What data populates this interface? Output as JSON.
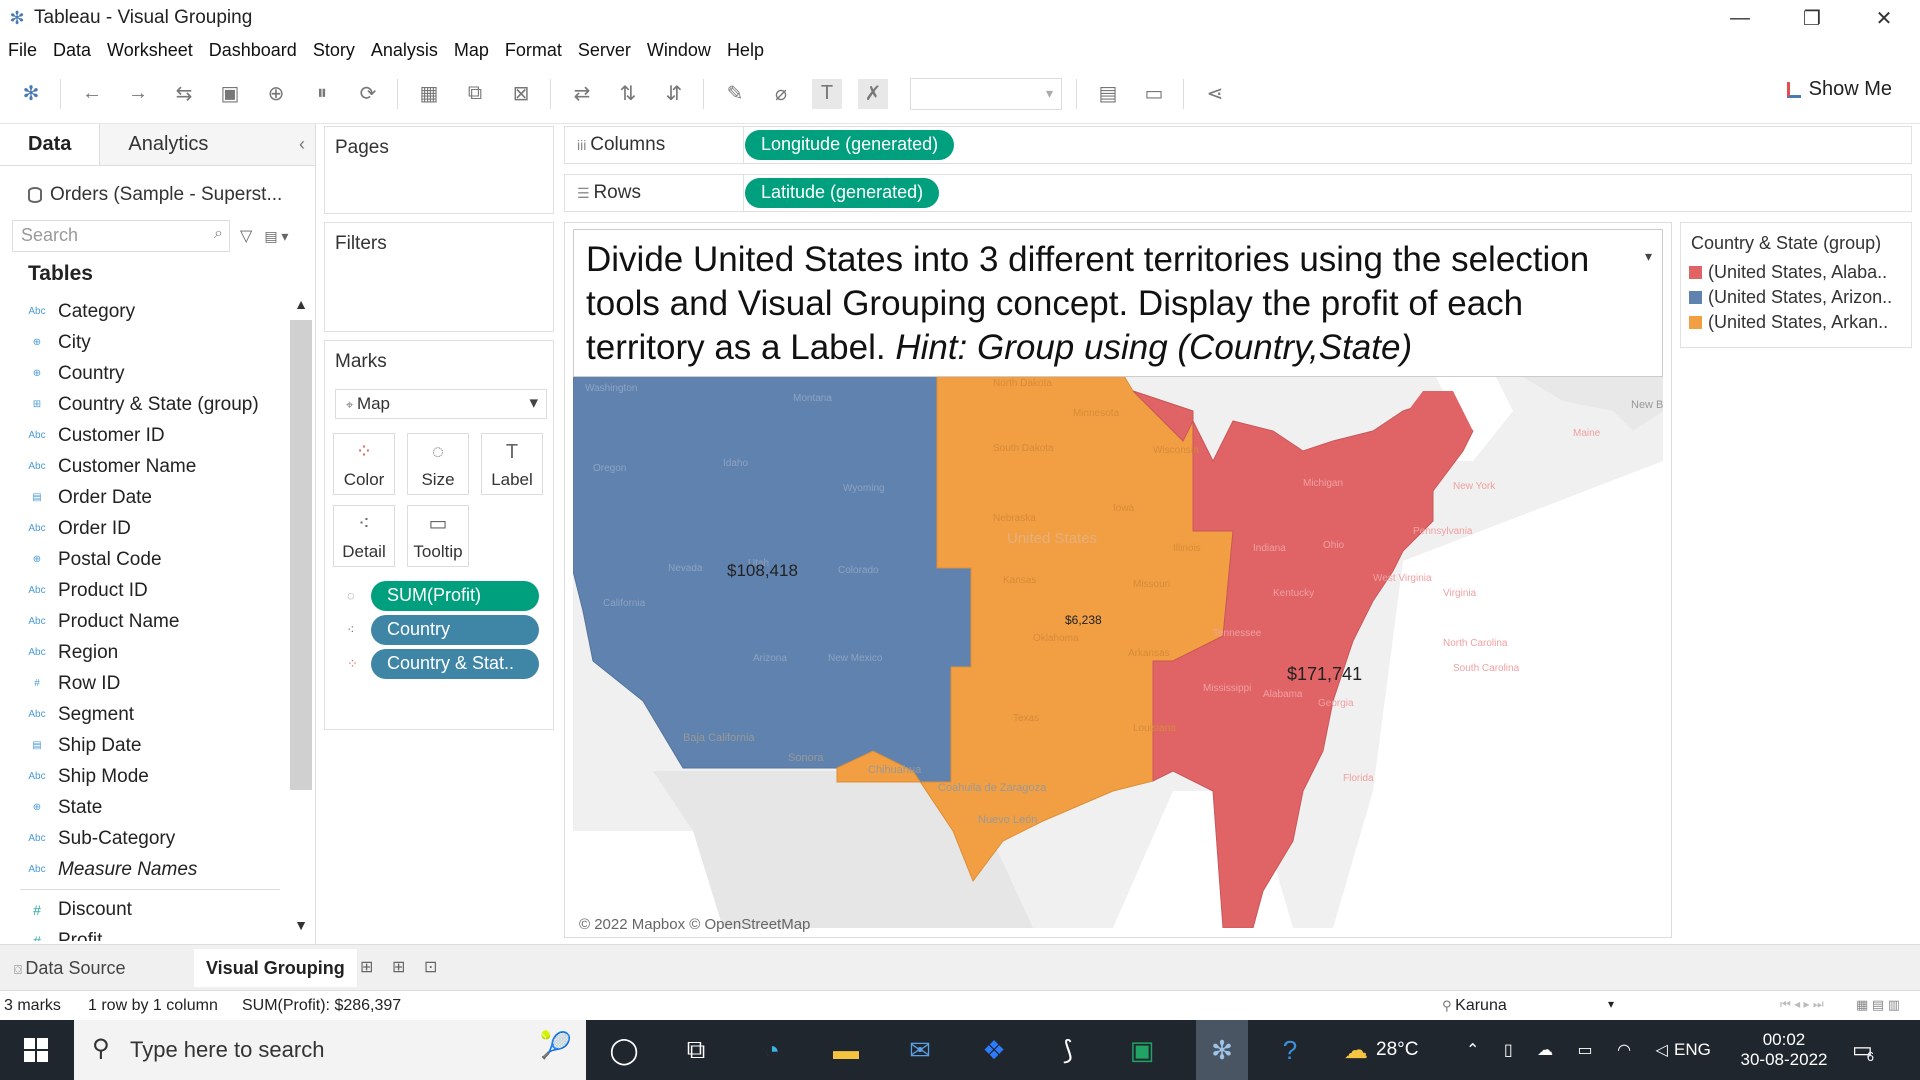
{
  "window": {
    "title": "Tableau - Visual Grouping"
  },
  "menu": [
    "File",
    "Data",
    "Worksheet",
    "Dashboard",
    "Story",
    "Analysis",
    "Map",
    "Format",
    "Server",
    "Window",
    "Help"
  ],
  "toolbar": {
    "show_me": "Show Me"
  },
  "data_pane": {
    "tab_data": "Data",
    "tab_analytics": "Analytics",
    "datasource": "Orders (Sample - Superst...",
    "search_placeholder": "Search",
    "tables_heading": "Tables",
    "dimensions": [
      {
        "icon": "Abc",
        "name": "Category"
      },
      {
        "icon": "⊕",
        "name": "City"
      },
      {
        "icon": "⊕",
        "name": "Country"
      },
      {
        "icon": "⊞",
        "name": "Country & State (group)"
      },
      {
        "icon": "Abc",
        "name": "Customer ID"
      },
      {
        "icon": "Abc",
        "name": "Customer Name"
      },
      {
        "icon": "▤",
        "name": "Order Date"
      },
      {
        "icon": "Abc",
        "name": "Order ID"
      },
      {
        "icon": "⊕",
        "name": "Postal Code"
      },
      {
        "icon": "Abc",
        "name": "Product ID"
      },
      {
        "icon": "Abc",
        "name": "Product Name"
      },
      {
        "icon": "Abc",
        "name": "Region"
      },
      {
        "icon": "#",
        "name": "Row ID"
      },
      {
        "icon": "Abc",
        "name": "Segment"
      },
      {
        "icon": "▤",
        "name": "Ship Date"
      },
      {
        "icon": "Abc",
        "name": "Ship Mode"
      },
      {
        "icon": "⊕",
        "name": "State"
      },
      {
        "icon": "Abc",
        "name": "Sub-Category"
      },
      {
        "icon": "Abc",
        "name": "Measure Names"
      }
    ],
    "measures": [
      {
        "icon": "#",
        "name": "Discount"
      },
      {
        "icon": "#",
        "name": "Profit"
      }
    ]
  },
  "pages_title": "Pages",
  "filters_title": "Filters",
  "marks": {
    "title": "Marks",
    "type": "Map",
    "buttons": {
      "color": "Color",
      "size": "Size",
      "label": "Label",
      "detail": "Detail",
      "tooltip": "Tooltip"
    },
    "pills": [
      "SUM(Profit)",
      "Country",
      "Country & Stat.."
    ]
  },
  "shelves": {
    "columns_label": "Columns",
    "columns_pill": "Longitude (generated)",
    "rows_label": "Rows",
    "rows_pill": "Latitude (generated)"
  },
  "view": {
    "title_line1": "Divide United States into 3 different territories using the selection",
    "title_line2": "tools and Visual Grouping concept. Display the profit of each",
    "title_line3_plain": "territory as a Label. ",
    "title_line3_hint": "Hint: Group using (Country,State)",
    "labels": {
      "west": "$108,418",
      "central": "$6,238",
      "east": "$171,741"
    },
    "attribution": "© 2022 Mapbox © OpenStreetMap",
    "basemap_labels": [
      "Washington",
      "Montana",
      "North Dakota",
      "Minnesota",
      "Oregon",
      "Idaho",
      "Wyoming",
      "South Dakota",
      "Wisconsin",
      "Michigan",
      "New York",
      "Maine",
      "Nevada",
      "Utah",
      "Colorado",
      "Nebraska",
      "Iowa",
      "Illinois",
      "Indiana",
      "Ohio",
      "Pennsylvania",
      "California",
      "Kansas",
      "Missouri",
      "Kentucky",
      "West Virginia",
      "Virginia",
      "Arizona",
      "New Mexico",
      "Oklahoma",
      "Arkansas",
      "Tennessee",
      "North Carolina",
      "South Carolina",
      "Mississippi",
      "Alabama",
      "Georgia",
      "Texas",
      "Louisiana",
      "Baja California",
      "Sonora",
      "Chihuahua",
      "Coahuila de Zaragoza",
      "Nuevo León",
      "New Brunsw",
      "United States",
      "Florida"
    ],
    "colors": {
      "east": "#e06366",
      "west": "#5f82af",
      "central": "#f29f43"
    }
  },
  "legend": {
    "title": "Country & State (group)",
    "items": [
      {
        "label": "(United States, Alaba..",
        "color": "#e06366"
      },
      {
        "label": "(United States, Arizon..",
        "color": "#5f82af"
      },
      {
        "label": "(United States, Arkan..",
        "color": "#f29f43"
      }
    ]
  },
  "sheet_tabs": {
    "data_source": "Data Source",
    "active_sheet": "Visual Grouping"
  },
  "status": {
    "marks": "3 marks",
    "dims": "1 row by 1 column",
    "sum": "SUM(Profit): $286,397",
    "user": "Karuna"
  },
  "taskbar": {
    "search_placeholder": "Type here to search",
    "weather": "28°C",
    "lang": "ENG",
    "time": "00:02",
    "date": "30-08-2022",
    "notifications": "6"
  }
}
